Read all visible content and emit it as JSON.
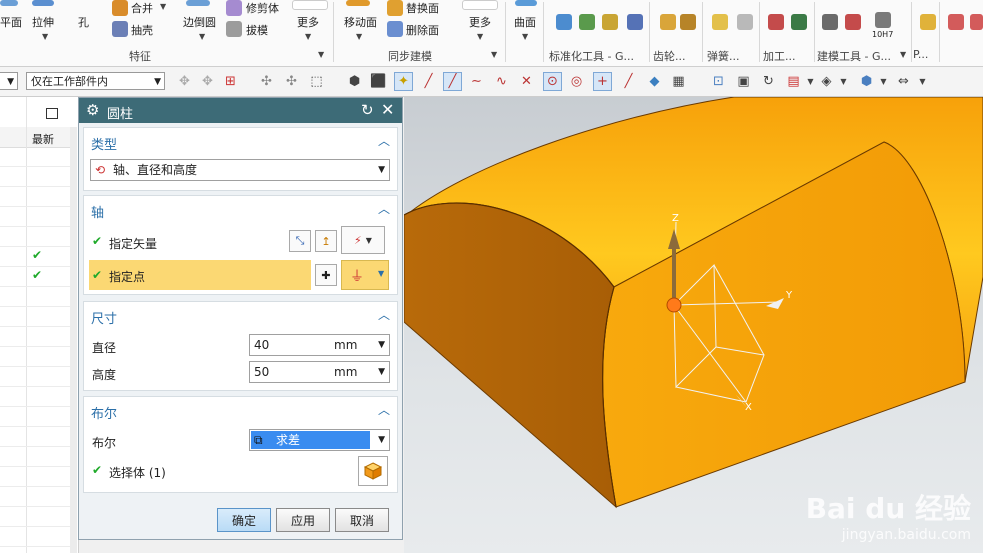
{
  "ribbon": {
    "items": {
      "plane": "平面",
      "extrude": "拉伸",
      "hole": "孔",
      "combine": "合并",
      "shell": "抽壳",
      "edge_blend": "边倒圆",
      "trim_body": "修剪体",
      "draft": "拔模",
      "more1": "更多",
      "move_face": "移动面",
      "replace_face": "替换面",
      "delete_face": "删除面",
      "more2": "更多",
      "surface": "曲面"
    },
    "groups": {
      "feature": "特征",
      "sync_modeling": "同步建模",
      "std_tools": "标准化工具 - G...",
      "gear": "齿轮...",
      "spring": "弹簧...",
      "machining": "加工...",
      "build_tools": "建模工具 - G...",
      "last": "P..."
    },
    "small_labels": {
      "tol": "10H7"
    }
  },
  "toolbar": {
    "filter_value": "仅在工作部件内"
  },
  "navigator": {
    "header": "最新",
    "checked_rows": [
      6,
      7
    ]
  },
  "dialog": {
    "title": "圆柱",
    "type": {
      "heading": "类型",
      "value": "轴、直径和高度"
    },
    "axis": {
      "heading": "轴",
      "vector_label": "指定矢量",
      "point_label": "指定点"
    },
    "size": {
      "heading": "尺寸",
      "diameter_label": "直径",
      "diameter_value": "40",
      "diameter_unit": "mm",
      "height_label": "高度",
      "height_value": "50",
      "height_unit": "mm"
    },
    "boolean": {
      "heading": "布尔",
      "label": "布尔",
      "value": "求差",
      "select_body_label": "选择体 (1)"
    },
    "buttons": {
      "ok": "确定",
      "apply": "应用",
      "cancel": "取消"
    }
  },
  "viewport": {
    "triad": {
      "x": "X",
      "y": "Y",
      "z": "Z"
    },
    "watermark_brand": "Bai du 经验",
    "watermark_url": "jingyan.baidu.com"
  },
  "colors": {
    "accent": "#2b6fa8",
    "title_bar": "#3d6b77",
    "highlight_row": "#fbd873",
    "body": "#f7a80e"
  }
}
